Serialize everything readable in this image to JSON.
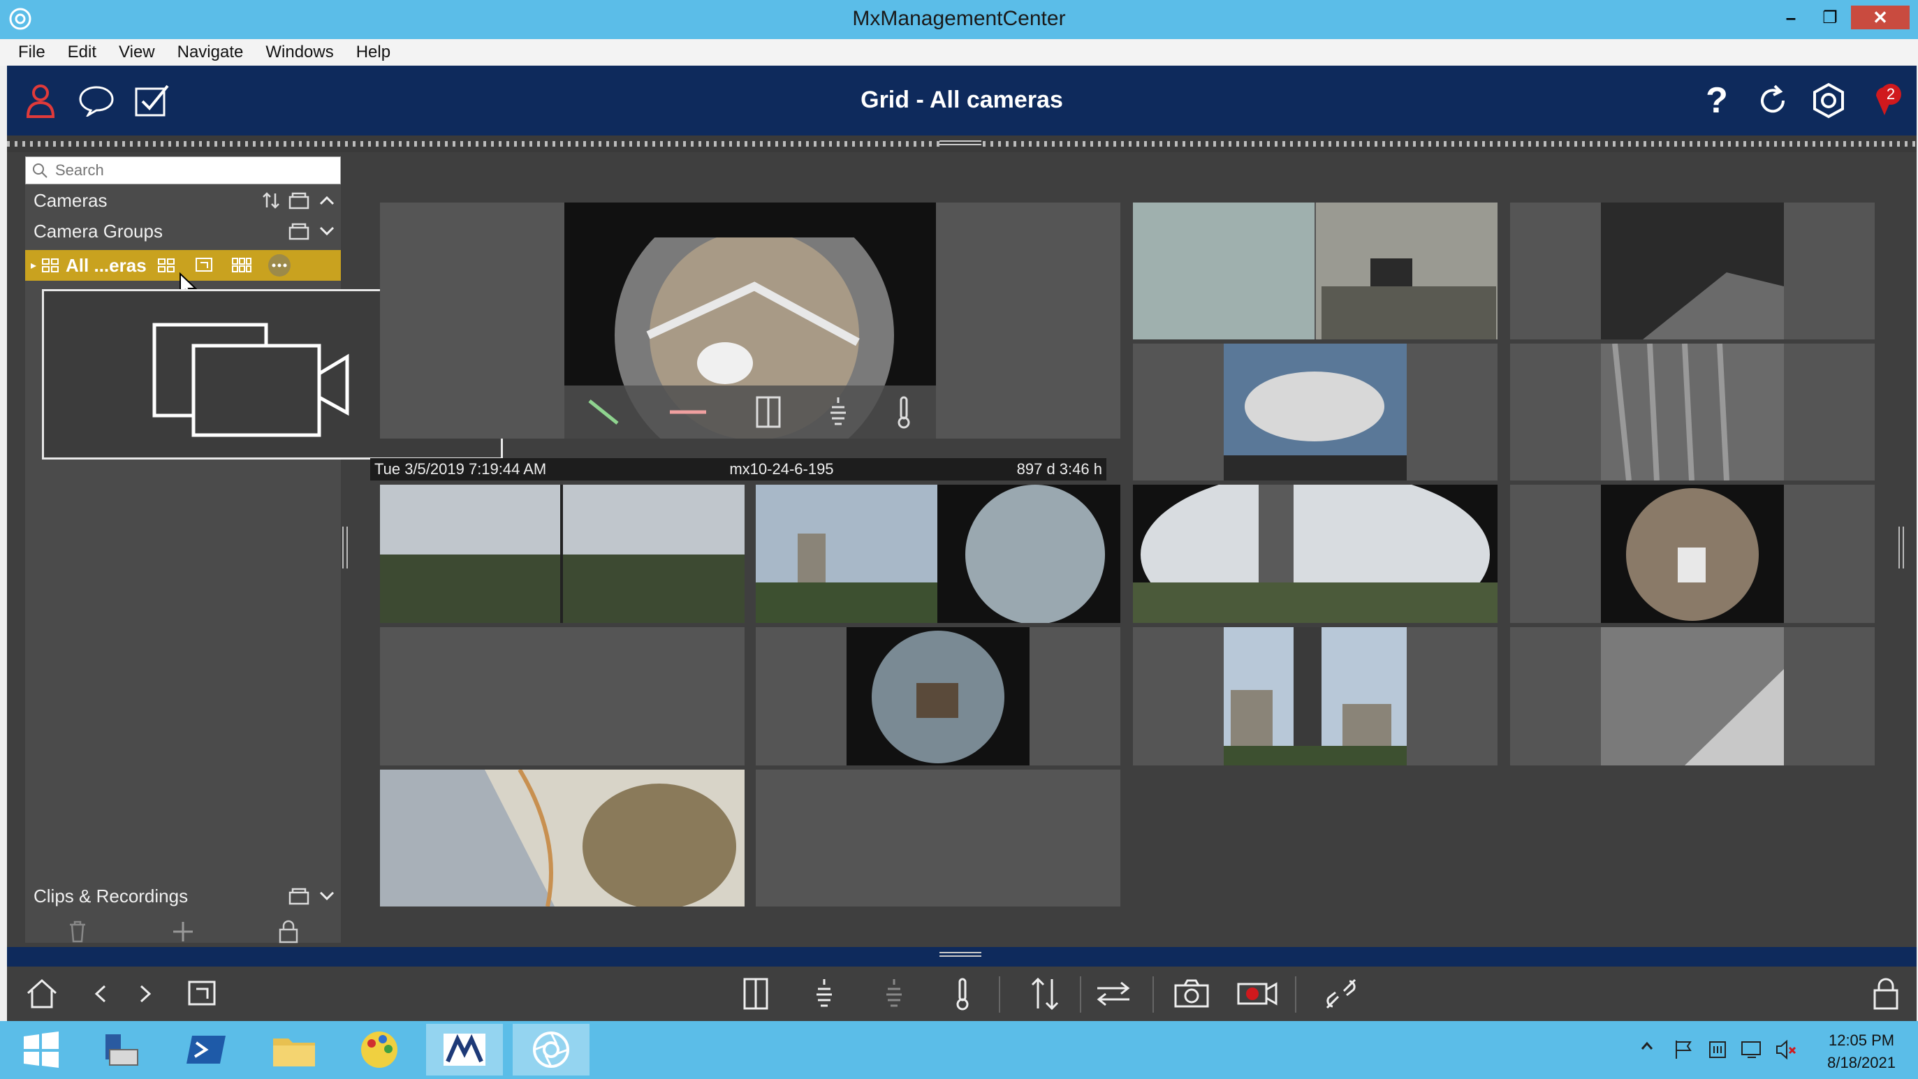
{
  "window": {
    "title": "MxManagementCenter",
    "minimize": "–",
    "restore": "❐",
    "close": "✕"
  },
  "menu": [
    "File",
    "Edit",
    "View",
    "Navigate",
    "Windows",
    "Help"
  ],
  "header": {
    "title": "Grid - All cameras",
    "notification_count": "2"
  },
  "sidebar": {
    "search_placeholder": "Search",
    "cameras_label": "Cameras",
    "camera_groups_label": "Camera Groups",
    "selected_group_label": "All ...eras",
    "clips_label": "Clips & Recordings"
  },
  "camera_info": {
    "timestamp": "Tue 3/5/2019 7:19:44 AM",
    "camera_name": "mx10-24-6-195",
    "uptime": "897 d 3:46 h"
  },
  "taskbar": {
    "time": "12:05 PM",
    "date": "8/18/2021"
  },
  "colors": {
    "header": "#0e2a5c",
    "selection": "#c9a21f",
    "titlebar": "#5bbde8",
    "record": "#d0191d"
  }
}
